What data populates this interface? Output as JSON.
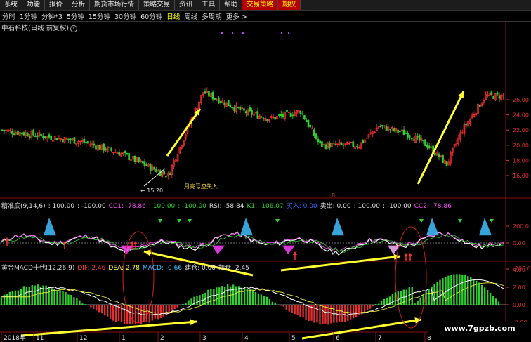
{
  "menu": [
    {
      "label": "系统",
      "active": false
    },
    {
      "label": "功能",
      "active": false
    },
    {
      "label": "报价",
      "active": false
    },
    {
      "label": "分析",
      "active": false
    },
    {
      "label": "期货市场行情",
      "active": false
    },
    {
      "label": "策略交易",
      "active": false
    },
    {
      "label": "资讯",
      "active": false
    },
    {
      "label": "工具",
      "active": false
    },
    {
      "label": "帮助",
      "active": false
    },
    {
      "label": "交易策略",
      "active": true
    },
    {
      "label": "期权",
      "active": true
    }
  ],
  "periods": [
    {
      "label": "分时",
      "sel": false
    },
    {
      "label": "1分钟",
      "sel": false
    },
    {
      "label": "分钟*3",
      "sel": false
    },
    {
      "label": "5分钟",
      "sel": false
    },
    {
      "label": "15分钟",
      "sel": false
    },
    {
      "label": "30分钟",
      "sel": false
    },
    {
      "label": "60分钟",
      "sel": false
    },
    {
      "label": "日线",
      "sel": true
    },
    {
      "label": "周线",
      "sel": false
    },
    {
      "label": "多周期",
      "sel": false
    },
    {
      "label": "更多 >",
      "sel": false
    }
  ],
  "stock": {
    "title": "中石科技(日线 前复权)",
    "icon": "x"
  },
  "price_axis": [
    "26.00",
    "24.00",
    "22.00",
    "20.00",
    "18.00",
    "16.00"
  ],
  "low_label": "← 15.20",
  "annotation": "月亮亏应失入",
  "mid_marker": "8",
  "ind1": {
    "name": "精准底(9,14,6)",
    "items": [
      {
        "t": ": 100.00",
        "c": "#ddd"
      },
      {
        "t": ": -100.00",
        "c": "#ddd"
      },
      {
        "t": "CC1: -78.86",
        "c": "#ff4dff"
      },
      {
        "t": ": 100.00",
        "c": "#30d030"
      },
      {
        "t": ": -100.00",
        "c": "#30d030"
      },
      {
        "t": "RSI: -58.84",
        "c": "#ddd"
      },
      {
        "t": "K1: -106.07",
        "c": "#30d030"
      },
      {
        "t": "买入: 0.00",
        "c": "#3a6bff"
      },
      {
        "t": "卖出: 0.00",
        "c": "#ddd"
      },
      {
        "t": ": 100.00",
        "c": "#ddd"
      },
      {
        "t": ": -100.00",
        "c": "#ddd"
      },
      {
        "t": "CC2: -78.86",
        "c": "#ff4dff"
      }
    ],
    "axis": [
      "200.0",
      "0.00",
      "-200.0"
    ]
  },
  "ind2": {
    "name": "黄金MACD十代(12,26,9)",
    "items": [
      {
        "t": "DIF: 2.46",
        "c": "#ff4040"
      },
      {
        "t": "DEA: 2.78",
        "c": "#ffff40"
      },
      {
        "t": "MACD: -0.66",
        "c": "#40c0ff"
      },
      {
        "t": "建仓: 0.00",
        "c": "#ddd"
      },
      {
        "t": "加仓: 2.45",
        "c": "#ddd"
      }
    ],
    "axis": [
      "4.00",
      "2.00",
      "0.00",
      "-2.00"
    ]
  },
  "dates": [
    "2018年",
    "11",
    "12",
    "1",
    "2",
    "3",
    "4",
    "5",
    "6",
    "7",
    "8"
  ],
  "watermark": "www.7gpzb.com",
  "colors": {
    "up": "#ff3030",
    "down": "#30d030",
    "arrow": "#ffff30",
    "axis": "#e03030"
  }
}
